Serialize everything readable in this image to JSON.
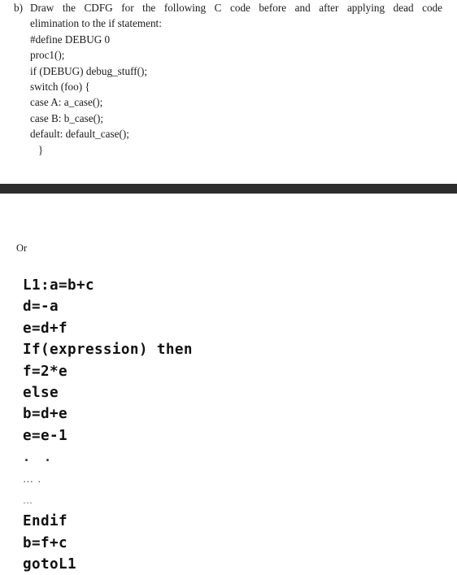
{
  "page": {
    "background_color": "#ffffff",
    "text_color": "#1a1a1a"
  },
  "question": {
    "marker": "b)",
    "lead_line": "Draw the CDFG for the following C code before and after applying dead code",
    "continuation_line": "elimination to the if statement:",
    "code_lines": [
      "#define DEBUG 0",
      "proc1();",
      "if (DEBUG) debug_stuff();",
      "switch (foo) {",
      "case A: a_case();",
      "case B: b_case();",
      "default: default_case();",
      "   }"
    ]
  },
  "divider": {
    "color": "#2d2d2d",
    "name": "black-separator-bar"
  },
  "or_label": "Or",
  "pseudocode": {
    "lines": [
      {
        "text": "L1:a=b+c",
        "style": "mono"
      },
      {
        "text": "d=-a",
        "style": "mono"
      },
      {
        "text": "e=d+f",
        "style": "mono"
      },
      {
        "text": "If(expression) then",
        "style": "mono"
      },
      {
        "text": "f=2*e",
        "style": "mono"
      },
      {
        "text": "else",
        "style": "mono"
      },
      {
        "text": "b=d+e",
        "style": "mono"
      },
      {
        "text": "e=e-1",
        "style": "mono"
      },
      {
        "text": ". .",
        "style": "dots-wide"
      },
      {
        "text": "… .",
        "style": "dots-mixed"
      },
      {
        "text": "…",
        "style": "dots-small"
      },
      {
        "text": "Endif",
        "style": "mono"
      },
      {
        "text": "b=f+c",
        "style": "mono"
      },
      {
        "text": "gotoL1",
        "style": "mono"
      }
    ]
  }
}
